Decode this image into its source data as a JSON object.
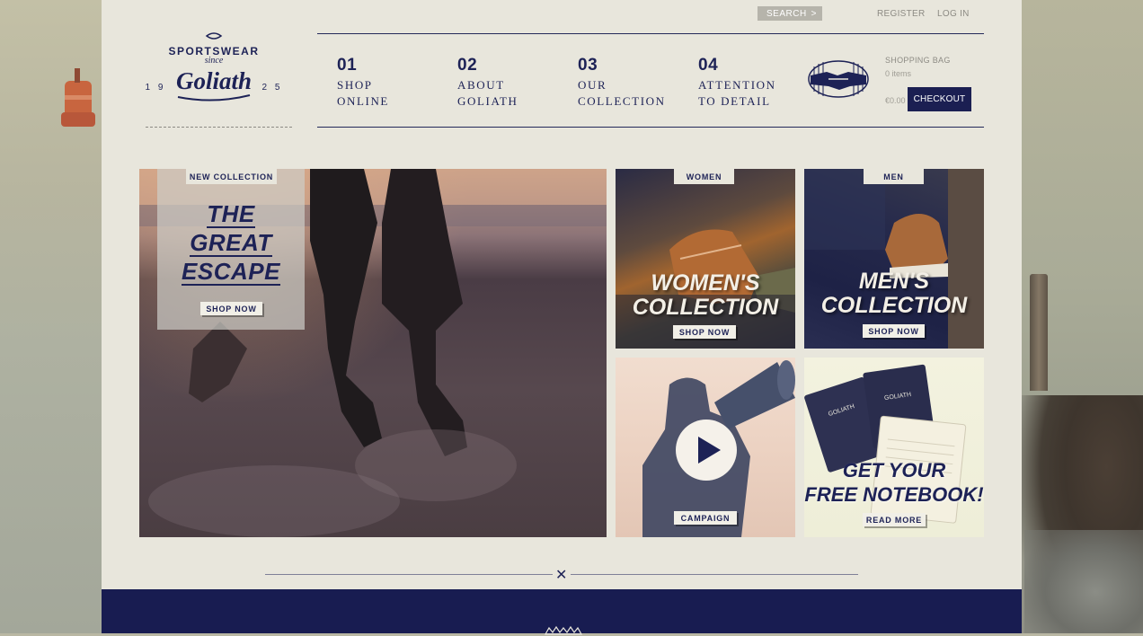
{
  "topbar": {
    "search_label": "SEARCH",
    "search_arrow": ">",
    "register": "REGISTER",
    "login": "LOG IN"
  },
  "logo": {
    "line1": "SPORTSWEAR",
    "line2": "since",
    "brand": "Goliath",
    "year_left": "1 9",
    "year_right": "2 5"
  },
  "nav": {
    "items": [
      {
        "num": "01",
        "line1": "SHOP",
        "line2": "ONLINE"
      },
      {
        "num": "02",
        "line1": "ABOUT",
        "line2": "GOLIATH"
      },
      {
        "num": "03",
        "line1": "OUR",
        "line2": "COLLECTION"
      },
      {
        "num": "04",
        "line1": "ATTENTION",
        "line2": "TO DETAIL"
      }
    ]
  },
  "bag": {
    "title": "SHOPPING BAG",
    "items": "0 items",
    "total": "€0.00",
    "checkout": "CHECKOUT"
  },
  "hero": {
    "tab": "NEW COLLECTION",
    "title_lines": [
      "THE",
      "GREAT",
      "ESCAPE"
    ],
    "button": "SHOP NOW"
  },
  "women": {
    "tab": "WOMEN",
    "title_lines": [
      "WOMEN'S",
      "COLLECTION"
    ],
    "button": "SHOP NOW"
  },
  "men": {
    "tab": "MEN",
    "title_lines": [
      "MEN'S",
      "COLLECTION"
    ],
    "button": "SHOP NOW"
  },
  "campaign": {
    "button": "CAMPAIGN"
  },
  "notebook": {
    "title_lines": [
      "GET YOUR",
      "FREE NOTEBOOK!"
    ],
    "button": "READ MORE"
  },
  "divider": {
    "symbol": "✕"
  },
  "colors": {
    "navy": "#1d2256",
    "page_bg": "#e8e6dc",
    "footer_bg": "#181c51"
  }
}
